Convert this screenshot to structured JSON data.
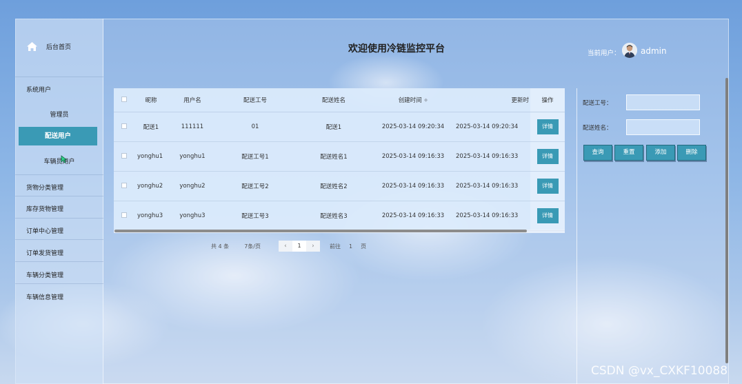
{
  "app": {
    "home_label": "后台首页",
    "title": "欢迎使用冷链监控平台",
    "current_user_label": "当前用户：",
    "username": "admin"
  },
  "sidebar": {
    "group": "系统用户",
    "sub_items": [
      "管理员",
      "配送用户",
      "车辆员用户"
    ],
    "active_sub": "配送用户",
    "items": [
      "货物分类管理",
      "库存货物管理",
      "订单中心管理",
      "订单发货管理",
      "车辆分类管理",
      "车辆信息管理"
    ]
  },
  "table": {
    "headers": [
      "昵称",
      "用户名",
      "配送工号",
      "配送姓名",
      "创建时间",
      "更新时",
      "操作"
    ],
    "detail_label": "详情",
    "rows": [
      {
        "nickname": "配送1",
        "username": "111111",
        "worker_id": "01",
        "name": "配送1",
        "created": "2025-03-14 09:20:34",
        "updated": "2025-03-14 09:20:34"
      },
      {
        "nickname": "yonghu1",
        "username": "yonghu1",
        "worker_id": "配送工号1",
        "name": "配送姓名1",
        "created": "2025-03-14 09:16:33",
        "updated": "2025-03-14 09:16:33"
      },
      {
        "nickname": "yonghu2",
        "username": "yonghu2",
        "worker_id": "配送工号2",
        "name": "配送姓名2",
        "created": "2025-03-14 09:16:33",
        "updated": "2025-03-14 09:16:33"
      },
      {
        "nickname": "yonghu3",
        "username": "yonghu3",
        "worker_id": "配送工号3",
        "name": "配送姓名3",
        "created": "2025-03-14 09:16:33",
        "updated": "2025-03-14 09:16:33"
      }
    ]
  },
  "pagination": {
    "total": "共 4 条",
    "page_size": "7条/页",
    "current": "1",
    "goto_label": "前往",
    "goto_value": "1",
    "page_unit": "页"
  },
  "search": {
    "worker_id_label": "配送工号：",
    "worker_id_value": "",
    "name_label": "配送姓名：",
    "name_value": "",
    "query_label": "查询",
    "reset_label": "重置",
    "add_label": "添加",
    "delete_label": "删除"
  },
  "watermark": "CSDN @vx_CXKF10088",
  "colors": {
    "accent": "#3a9ab5",
    "sky": "#8db6e6"
  }
}
